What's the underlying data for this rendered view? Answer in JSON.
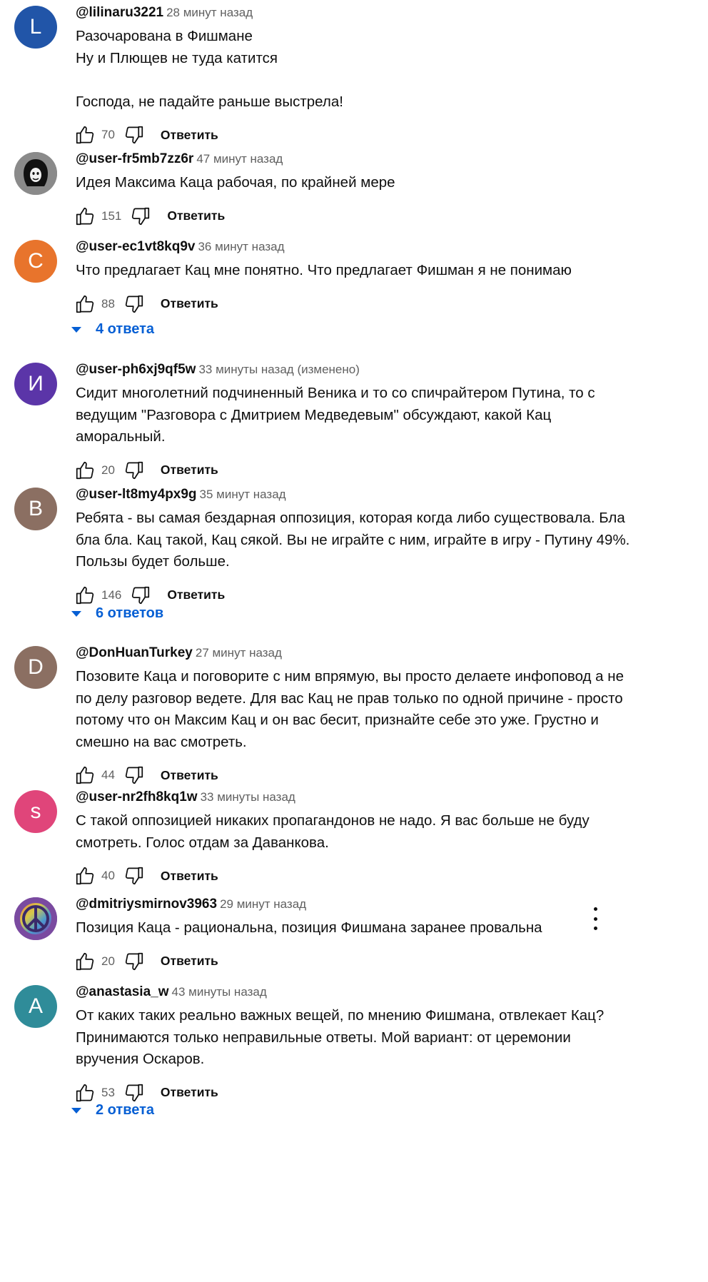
{
  "labels": {
    "reply": "Ответить"
  },
  "comments": [
    {
      "author": "@lilinaru3221",
      "time": "28 минут назад",
      "avatar_letter": "L",
      "avatar_color": "#2155a8",
      "text": "Разочарована в Фишмане\nНу и Плющев не туда катится\n\nГоспода, не падайте раньше выстрела!",
      "likes": "70"
    },
    {
      "author": "@user-fr5mb7zz6r",
      "time": "47 минут назад",
      "avatar_letter": "",
      "avatar_color": "#8a8a8a",
      "avatar_icon": "hooded-figure-icon",
      "text": "Идея Максима Каца рабочая, по крайней мере",
      "likes": "151"
    },
    {
      "author": "@user-ec1vt8kq9v",
      "time": "36 минут назад",
      "avatar_letter": "C",
      "avatar_color": "#e8742c",
      "text": "Что предлагает Кац мне понятно. Что предлагает Фишман я не понимаю",
      "likes": "88",
      "replies": "4 ответа"
    },
    {
      "author": "@user-ph6xj9qf5w",
      "time": "33 минуты назад (изменено)",
      "avatar_letter": "И",
      "avatar_color": "#5b35a8",
      "text": "Сидит многолетний подчиненный Веника и то со спичрайтером Путина, то с\nведущим \"Разговора с Дмитрием Медведевым\" обсуждают, какой Кац\nаморальный.",
      "likes": "20"
    },
    {
      "author": "@user-lt8my4px9g",
      "time": "35 минут назад",
      "avatar_letter": "B",
      "avatar_color": "#8b6f62",
      "text": "Ребята - вы самая бездарная оппозиция, которая когда либо существовала. Бла\nбла бла. Кац такой, Кац сякой. Вы не играйте с ним, играйте в игру - Путину 49%.\nПользы будет больше.",
      "likes": "146",
      "replies": "6 ответов"
    },
    {
      "author": "@DonHuanTurkey",
      "time": "27 минут назад",
      "avatar_letter": "D",
      "avatar_color": "#8b6f62",
      "text": "Позовите Каца и поговорите с ним впрямую, вы просто делаете инфоповод а не\nпо делу разговор ведете. Для вас Кац не прав только по одной причине - просто\nпотому что он Максим Кац и он вас бесит, признайте себе это уже. Грустно и\nсмешно на вас смотреть.",
      "likes": "44"
    },
    {
      "author": "@user-nr2fh8kq1w",
      "time": "33 минуты назад",
      "avatar_letter": "s",
      "avatar_color": "#e0457a",
      "text": "С такой оппозицией никаких пропагандонов не надо. Я вас больше не буду\nсмотреть. Голос отдам за Даванкова.",
      "likes": "40"
    },
    {
      "author": "@dmitriysmirnov3963",
      "time": "29 минут назад",
      "avatar_letter": "",
      "avatar_color": "#7a4aa0",
      "avatar_icon": "peace-sign-icon",
      "text": "Позиция Каца - рациональна, позиция Фишмана заранее провальна",
      "likes": "20",
      "menu": true
    },
    {
      "author": "@anastasia_w",
      "time": "43 минуты назад",
      "avatar_letter": "A",
      "avatar_color": "#2f8c99",
      "text": "От каких таких реально важных вещей, по мнению Фишмана, отвлекает Кац?\nПринимаются только неправильные ответы. Мой вариант: от церемонии\nвручения Оскаров.",
      "likes": "53",
      "replies": "2 ответа"
    }
  ]
}
